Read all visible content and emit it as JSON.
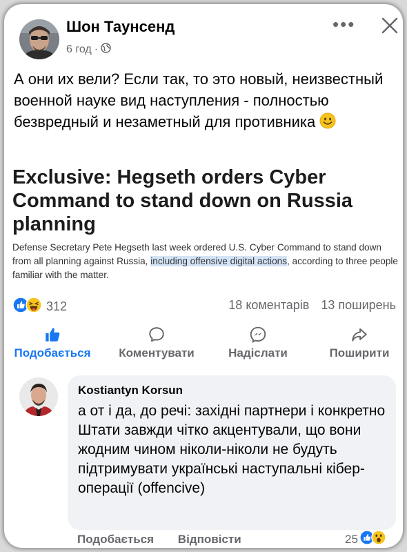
{
  "post": {
    "author": "Шон Таунсенд",
    "time": "6 год",
    "separator": "·",
    "text": "А они их вели? Если так, то это новый, неизвестный военной науке вид наступления - полностью безвредный и незаметный для противника"
  },
  "article": {
    "title": "Exclusive: Hegseth orders Cyber Command to stand down on Russia planning",
    "desc_before": "Defense Secretary Pete Hegseth last week ordered U.S. Cyber Command to stand down from all planning against Russia, ",
    "desc_highlight": "including offensive digital actions",
    "desc_after": ", according to three people familiar with the matter."
  },
  "stats": {
    "reactions_count": "312",
    "comments": "18 коментарів",
    "shares": "13 поширень"
  },
  "actions": {
    "like": "Подобається",
    "comment": "Коментувати",
    "send": "Надіслати",
    "share": "Поширити"
  },
  "comment": {
    "author": "Kostiantyn  Korsun",
    "text": "а от і да, до речі: західні партнери і конкретно Штати завжди чітко акцентували, що вони жодним чином ніколи-ніколи не будуть підтримувати українські наступальні кібер-операції (offencive)",
    "like_label": "Подобається",
    "reply_label": "Відповісти",
    "reactions_count": "25"
  },
  "colors": {
    "accent": "#1877f2",
    "secondary_text": "#65676b",
    "bubble": "#f0f2f5",
    "highlight": "#d4e4f7"
  },
  "icons": [
    "globe-icon",
    "more-icon",
    "close-icon",
    "smile-emoji",
    "like-reaction-icon",
    "haha-reaction-icon",
    "like-icon",
    "comment-icon",
    "messenger-icon",
    "share-icon",
    "wow-reaction-icon"
  ]
}
